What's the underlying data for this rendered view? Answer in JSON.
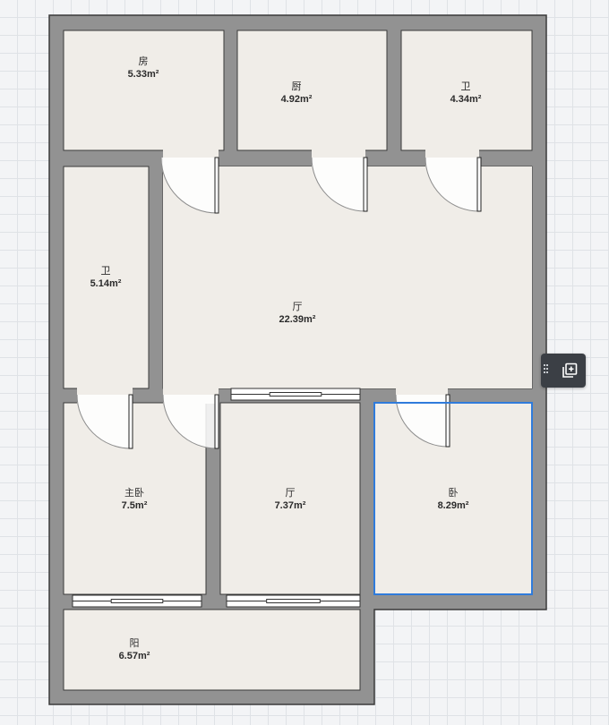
{
  "rooms": [
    {
      "id": "fang",
      "name": "房",
      "area": "5.33m²"
    },
    {
      "id": "chu",
      "name": "厨",
      "area": "4.92m²"
    },
    {
      "id": "wei1",
      "name": "卫",
      "area": "4.34m²"
    },
    {
      "id": "wei2",
      "name": "卫",
      "area": "5.14m²"
    },
    {
      "id": "ting1",
      "name": "厅",
      "area": "22.39m²"
    },
    {
      "id": "zhuwo",
      "name": "主卧",
      "area": "7.5m²"
    },
    {
      "id": "ting2",
      "name": "厅",
      "area": "7.37m²"
    },
    {
      "id": "wo",
      "name": "卧",
      "area": "8.29m²"
    },
    {
      "id": "yang",
      "name": "阳",
      "area": "6.57m²"
    }
  ],
  "selected_room": "wo",
  "colors": {
    "wall": "#929292",
    "wall_edge": "#3a3a3a",
    "floor": "#f0ede8",
    "selection": "#2f7bdb",
    "toolbar": "#3b3f45"
  },
  "toolbar": {
    "icon": "add-layer-icon"
  }
}
